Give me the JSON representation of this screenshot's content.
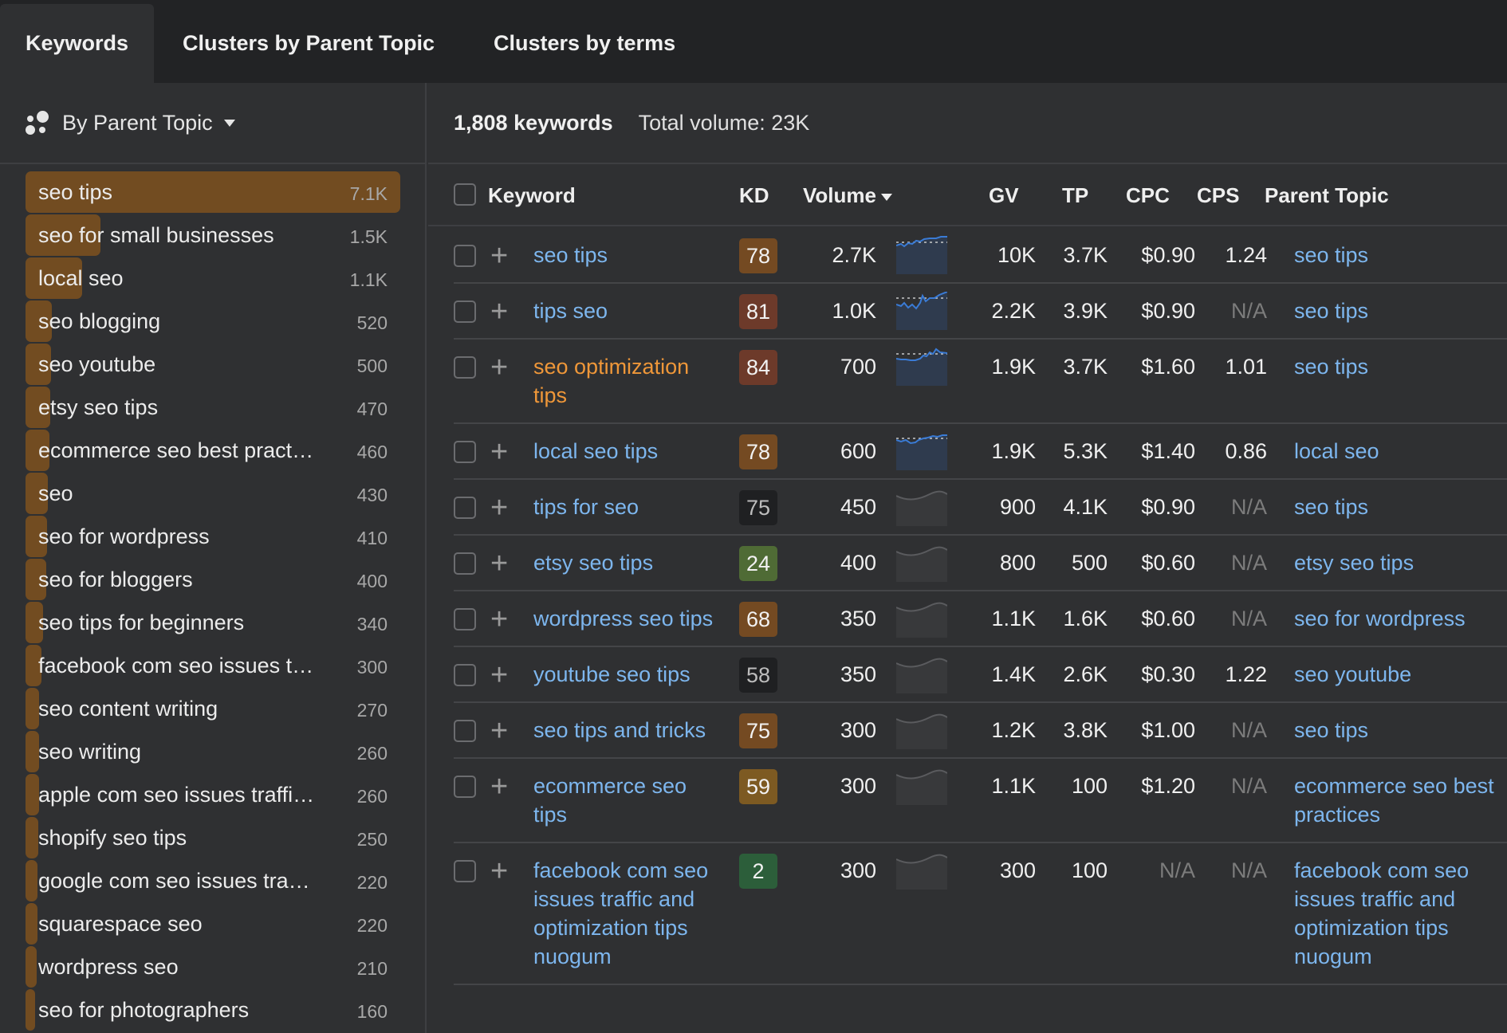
{
  "tabs": [
    {
      "label": "Keywords",
      "active": true
    },
    {
      "label": "Clusters by Parent Topic",
      "active": false
    },
    {
      "label": "Clusters by terms",
      "active": false
    }
  ],
  "sidebar": {
    "grouping_label": "By Parent Topic",
    "grouping_icon": "cluster-dots-icon",
    "items": [
      {
        "label": "seo tips",
        "count": "7.1K",
        "share": 1.0
      },
      {
        "label": "seo for small businesses",
        "count": "1.5K",
        "share": 0.2
      },
      {
        "label": "local seo",
        "count": "1.1K",
        "share": 0.15
      },
      {
        "label": "seo blogging",
        "count": "520",
        "share": 0.07
      },
      {
        "label": "seo youtube",
        "count": "500",
        "share": 0.068
      },
      {
        "label": "etsy seo tips",
        "count": "470",
        "share": 0.065
      },
      {
        "label": "ecommerce seo best pract…",
        "count": "460",
        "share": 0.063
      },
      {
        "label": "seo",
        "count": "430",
        "share": 0.06
      },
      {
        "label": "seo for wordpress",
        "count": "410",
        "share": 0.057
      },
      {
        "label": "seo for bloggers",
        "count": "400",
        "share": 0.055
      },
      {
        "label": "seo tips for beginners",
        "count": "340",
        "share": 0.047
      },
      {
        "label": "facebook com seo issues t…",
        "count": "300",
        "share": 0.042
      },
      {
        "label": "seo content writing",
        "count": "270",
        "share": 0.037
      },
      {
        "label": "seo writing",
        "count": "260",
        "share": 0.036
      },
      {
        "label": "apple com seo issues traffi…",
        "count": "260",
        "share": 0.036
      },
      {
        "label": "shopify seo tips",
        "count": "250",
        "share": 0.035
      },
      {
        "label": "google com seo issues tra…",
        "count": "220",
        "share": 0.031
      },
      {
        "label": "squarespace seo",
        "count": "220",
        "share": 0.031
      },
      {
        "label": "wordpress seo",
        "count": "210",
        "share": 0.03
      },
      {
        "label": "seo for photographers",
        "count": "160",
        "share": 0.022
      }
    ]
  },
  "summary": {
    "keywords_count": "1,808 keywords",
    "total_volume": "Total volume: 23K"
  },
  "table": {
    "headers": {
      "keyword": "Keyword",
      "kd": "KD",
      "volume": "Volume",
      "gv": "GV",
      "tp": "TP",
      "cpc": "CPC",
      "cps": "CPS",
      "parent_topic": "Parent Topic"
    },
    "sort_column": "Volume",
    "sort_direction": "desc",
    "kd_colors": {
      "dark": "#1f2022",
      "green_light": "#4f6b35",
      "green": "#2c5e3a",
      "amber": "#7d5a22",
      "orange": "#744a22",
      "brown": "#6f3e25",
      "red_brown": "#6d3a2a"
    },
    "rows": [
      {
        "keyword": "seo tips",
        "visited": false,
        "kd": "78",
        "kd_color": "#744a22",
        "volume": "2.7K",
        "trend": "blue",
        "gv": "10K",
        "tp": "3.7K",
        "cpc": "$0.90",
        "cps": "1.24",
        "parent_topic": "seo tips"
      },
      {
        "keyword": "tips seo",
        "visited": false,
        "kd": "81",
        "kd_color": "#6d3a2a",
        "volume": "1.0K",
        "trend": "blue",
        "gv": "2.2K",
        "tp": "3.9K",
        "cpc": "$0.90",
        "cps": "N/A",
        "parent_topic": "seo tips"
      },
      {
        "keyword": "seo optimization tips",
        "visited": true,
        "kd": "84",
        "kd_color": "#6d3a2a",
        "volume": "700",
        "trend": "blue",
        "gv": "1.9K",
        "tp": "3.7K",
        "cpc": "$1.60",
        "cps": "1.01",
        "parent_topic": "seo tips"
      },
      {
        "keyword": "local seo tips",
        "visited": false,
        "kd": "78",
        "kd_color": "#744a22",
        "volume": "600",
        "trend": "blue",
        "gv": "1.9K",
        "tp": "5.3K",
        "cpc": "$1.40",
        "cps": "0.86",
        "parent_topic": "local seo"
      },
      {
        "keyword": "tips for seo",
        "visited": false,
        "kd": "75",
        "kd_color": "#1f2022",
        "volume": "450",
        "trend": "gray",
        "gv": "900",
        "tp": "4.1K",
        "cpc": "$0.90",
        "cps": "N/A",
        "parent_topic": "seo tips"
      },
      {
        "keyword": "etsy seo tips",
        "visited": false,
        "kd": "24",
        "kd_color": "#4f6b35",
        "volume": "400",
        "trend": "gray",
        "gv": "800",
        "tp": "500",
        "cpc": "$0.60",
        "cps": "N/A",
        "parent_topic": "etsy seo tips"
      },
      {
        "keyword": "wordpress seo tips",
        "visited": false,
        "kd": "68",
        "kd_color": "#744a22",
        "volume": "350",
        "trend": "gray",
        "gv": "1.1K",
        "tp": "1.6K",
        "cpc": "$0.60",
        "cps": "N/A",
        "parent_topic": "seo for wordpress"
      },
      {
        "keyword": "youtube seo tips",
        "visited": false,
        "kd": "58",
        "kd_color": "#1f2022",
        "volume": "350",
        "trend": "gray",
        "gv": "1.4K",
        "tp": "2.6K",
        "cpc": "$0.30",
        "cps": "1.22",
        "parent_topic": "seo youtube"
      },
      {
        "keyword": "seo tips and tricks",
        "visited": false,
        "kd": "75",
        "kd_color": "#744a22",
        "volume": "300",
        "trend": "gray",
        "gv": "1.2K",
        "tp": "3.8K",
        "cpc": "$1.00",
        "cps": "N/A",
        "parent_topic": "seo tips"
      },
      {
        "keyword": "ecommerce seo tips",
        "visited": false,
        "kd": "59",
        "kd_color": "#7d5a22",
        "volume": "300",
        "trend": "gray",
        "gv": "1.1K",
        "tp": "100",
        "cpc": "$1.20",
        "cps": "N/A",
        "parent_topic": "ecommerce seo best practices"
      },
      {
        "keyword": "facebook com seo issues traffic and optimization tips nuogum",
        "visited": false,
        "kd": "2",
        "kd_color": "#2c5e3a",
        "volume": "300",
        "trend": "gray",
        "gv": "300",
        "tp": "100",
        "cpc": "N/A",
        "cps": "N/A",
        "parent_topic": "facebook com seo issues traffic and optimization tips nuogum"
      }
    ]
  },
  "colors": {
    "tabbar_bg": "#222325",
    "panel_bg": "#2f3032",
    "link": "#7db6ee",
    "visited_link": "#ef9739",
    "sidebar_bar": "#724c21",
    "trend_blue": "#3a7bd5"
  }
}
